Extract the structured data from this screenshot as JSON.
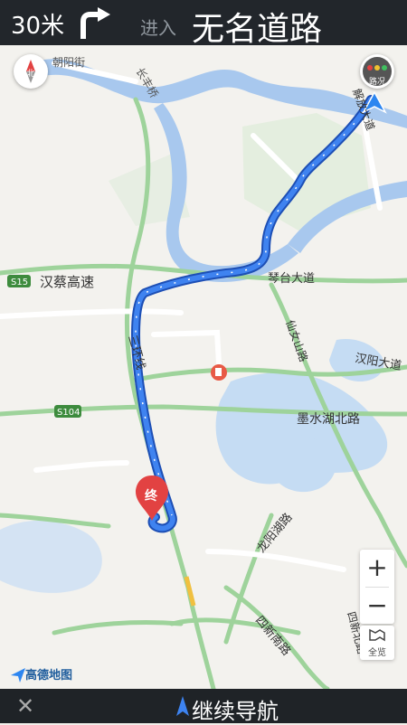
{
  "header": {
    "distance": "30米",
    "action": "进入",
    "road": "无名道路"
  },
  "map": {
    "roads": [
      "朝阳街",
      "长丰桥",
      "汉蔡高速",
      "琴台大道",
      "汉阳大道",
      "墨水湖北路",
      "龙阳湖路",
      "四新南路",
      "仙女山路",
      "解放大道",
      "三环线",
      "四新北路"
    ],
    "road_codes": [
      "S15",
      "S104"
    ],
    "destination": "终",
    "compass": "北",
    "traffic": "路况",
    "zoom_in": "+",
    "zoom_out": "−",
    "overview": "全览",
    "logo": "高德地图",
    "colors": {
      "route": "#2f71e7",
      "green_road": "#9ed39b",
      "water": "#a8c8ee",
      "header": "#22262b",
      "destination": "#e24242"
    }
  },
  "footer": {
    "close": "✕",
    "continue": "继续导航"
  }
}
